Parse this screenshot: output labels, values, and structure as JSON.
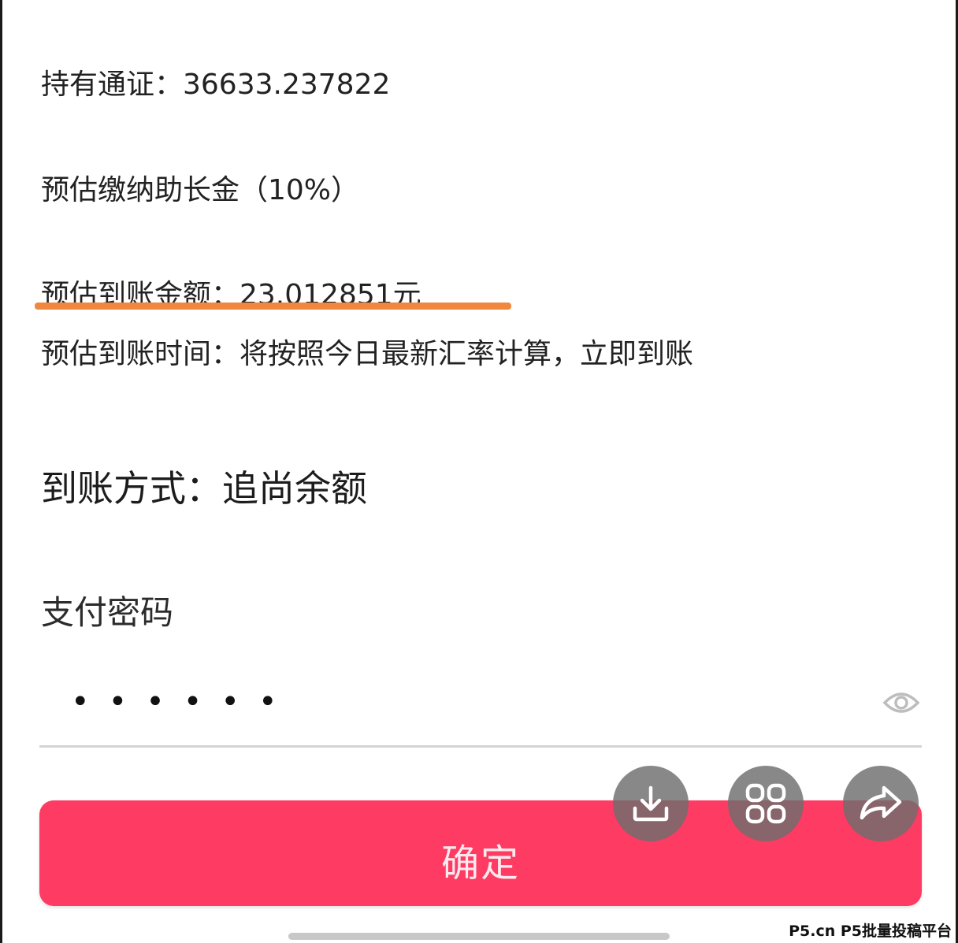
{
  "details": {
    "holdings": "持有通证：36633.237822",
    "fee": "预估缴纳助长金（10%）",
    "amount": "预估到账金额：23.012851元",
    "time": "预估到账时间：将按照今日最新汇率计算，立即到账",
    "method": "到账方式：追尚余额"
  },
  "payment": {
    "label": "支付密码",
    "masked_value": "••••••"
  },
  "confirm": {
    "label": "确定"
  },
  "overlay": {
    "download_icon": "download-icon",
    "apps_icon": "grid-icon",
    "share_icon": "share-icon"
  },
  "watermark": "P5.cn P5批量投稿平台",
  "colors": {
    "confirm_bg": "#fe3b62",
    "highlight": "#f0873e",
    "fab_bg": "#6e6e6e"
  }
}
